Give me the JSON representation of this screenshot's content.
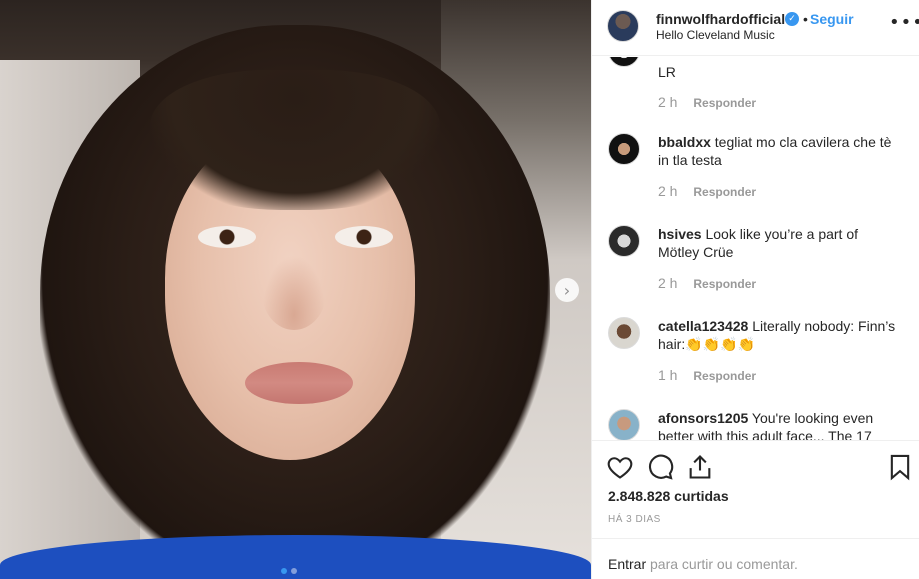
{
  "post": {
    "author": "finnwolfhardofficial",
    "verified_icon": "verified-badge-icon",
    "separator": "•",
    "follow_label": "Seguir",
    "location": "Hello Cleveland Music",
    "more_icon": "more-options-icon",
    "more_glyph": "•••",
    "next_glyph": "›",
    "carousel": {
      "slide_count": 2,
      "active_index": 0
    }
  },
  "comments": [
    {
      "username": "",
      "text": "LR",
      "time": "2 h",
      "reply_label": "Responder"
    },
    {
      "username": "bbaldxx",
      "text": "tegliat mo cla cavilera che tè in tla testa",
      "time": "2 h",
      "reply_label": "Responder"
    },
    {
      "username": "hsives",
      "text": "Look like you’re a part of Mötley Crüe",
      "time": "2 h",
      "reply_label": "Responder"
    },
    {
      "username": "catella123428",
      "text": "Literally nobody: Finn’s hair:👏👏👏👏",
      "time": "1 h",
      "reply_label": "Responder"
    },
    {
      "username": "afonsors1205",
      "text": "You're looking even better with this adult face... The 17",
      "time": "",
      "reply_label": ""
    }
  ],
  "actions": {
    "like_icon": "heart-icon",
    "comment_icon": "comment-icon",
    "share_icon": "share-icon",
    "save_icon": "bookmark-icon",
    "likes_text": "2.848.828 curtidas",
    "timestamp": "HÁ 3 DIAS"
  },
  "add_comment": {
    "login_label": "Entrar",
    "prompt": "para curtir ou comentar."
  },
  "colors": {
    "accent": "#3897f0",
    "text": "#262626",
    "muted": "#999999",
    "border": "#efefef"
  }
}
